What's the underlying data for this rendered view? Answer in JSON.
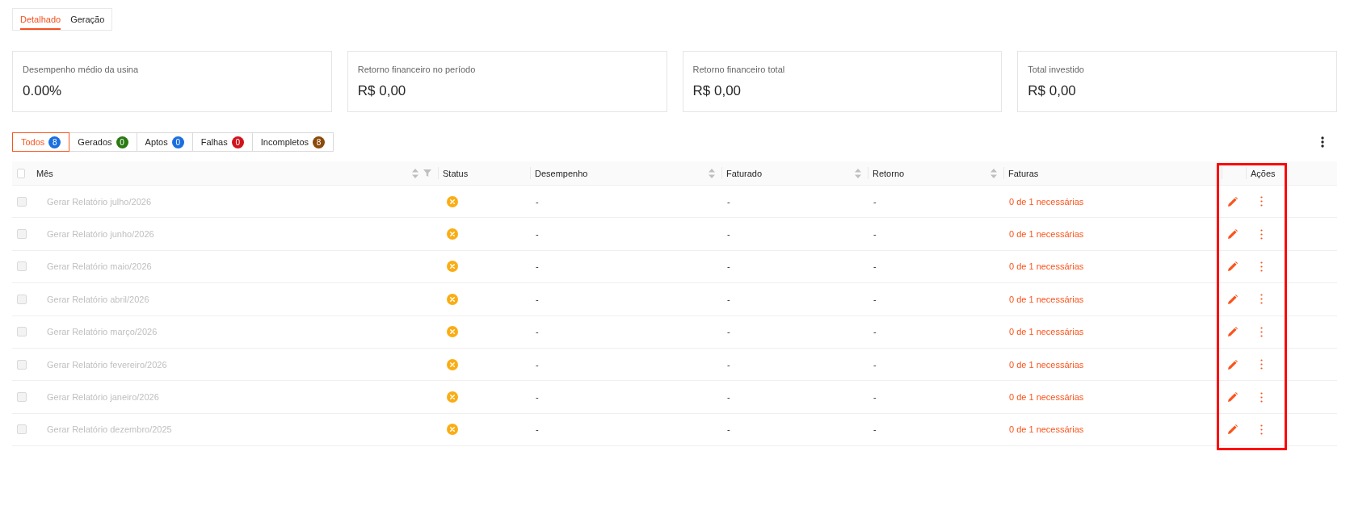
{
  "view_tabs": [
    {
      "label": "Detalhado",
      "selected": true
    },
    {
      "label": "Geração",
      "selected": false
    }
  ],
  "stats": [
    {
      "label": "Desempenho médio da usina",
      "value": "0.00%"
    },
    {
      "label": "Retorno financeiro no período",
      "value": "R$ 0,00"
    },
    {
      "label": "Retorno financeiro total",
      "value": "R$ 0,00"
    },
    {
      "label": "Total investido",
      "value": "R$ 0,00"
    }
  ],
  "filters": [
    {
      "label": "Todos",
      "count": "8",
      "color": "#1a6fe0",
      "selected": true
    },
    {
      "label": "Gerados",
      "count": "0",
      "color": "#2a7a12",
      "selected": false
    },
    {
      "label": "Aptos",
      "count": "0",
      "color": "#1a6fe0",
      "selected": false
    },
    {
      "label": "Falhas",
      "count": "0",
      "color": "#d0141c",
      "selected": false
    },
    {
      "label": "Incompletos",
      "count": "8",
      "color": "#8a4a0a",
      "selected": false
    }
  ],
  "table": {
    "select_all": {
      "checked": false
    },
    "columns": [
      {
        "label": "Mês",
        "sortable": true,
        "filterable": true
      },
      {
        "label": "Status",
        "sortable": false,
        "filterable": false
      },
      {
        "label": "Desempenho",
        "sortable": true,
        "filterable": false
      },
      {
        "label": "Faturado",
        "sortable": true,
        "filterable": false
      },
      {
        "label": "Retorno",
        "sortable": true,
        "filterable": false
      },
      {
        "label": "Faturas",
        "sortable": false,
        "filterable": false
      },
      {
        "label": "Ações",
        "sortable": false,
        "filterable": false
      }
    ],
    "rows": [
      {
        "month": "Gerar Relatório julho/2026",
        "checked": false,
        "disabled": true,
        "kind": "incomplete",
        "performance": "-",
        "billed": "-",
        "return": "-",
        "invoices": "0 de 1 necessárias"
      },
      {
        "month": "Gerar Relatório junho/2026",
        "checked": false,
        "disabled": true,
        "kind": "incomplete",
        "performance": "-",
        "billed": "-",
        "return": "-",
        "invoices": "0 de 1 necessárias"
      },
      {
        "month": "Gerar Relatório maio/2026",
        "checked": false,
        "disabled": true,
        "kind": "incomplete",
        "performance": "-",
        "billed": "-",
        "return": "-",
        "invoices": "0 de 1 necessárias"
      },
      {
        "month": "Gerar Relatório abril/2026",
        "checked": false,
        "disabled": true,
        "kind": "incomplete",
        "performance": "-",
        "billed": "-",
        "return": "-",
        "invoices": "0 de 1 necessárias"
      },
      {
        "month": "Gerar Relatório março/2026",
        "checked": false,
        "disabled": true,
        "kind": "incomplete",
        "performance": "-",
        "billed": "-",
        "return": "-",
        "invoices": "0 de 1 necessárias"
      },
      {
        "month": "Gerar Relatório fevereiro/2026",
        "checked": false,
        "disabled": true,
        "kind": "incomplete",
        "performance": "-",
        "billed": "-",
        "return": "-",
        "invoices": "0 de 1 necessárias"
      },
      {
        "month": "Gerar Relatório janeiro/2026",
        "checked": false,
        "disabled": true,
        "kind": "incomplete",
        "performance": "-",
        "billed": "-",
        "return": "-",
        "invoices": "0 de 1 necessárias"
      },
      {
        "month": "Gerar Relatório dezembro/2025",
        "checked": false,
        "disabled": true,
        "kind": "incomplete",
        "performance": "-",
        "billed": "-",
        "return": "-",
        "invoices": "0 de 1 necessárias"
      }
    ]
  },
  "annotations": [
    {
      "kind": "highlight-box"
    }
  ]
}
